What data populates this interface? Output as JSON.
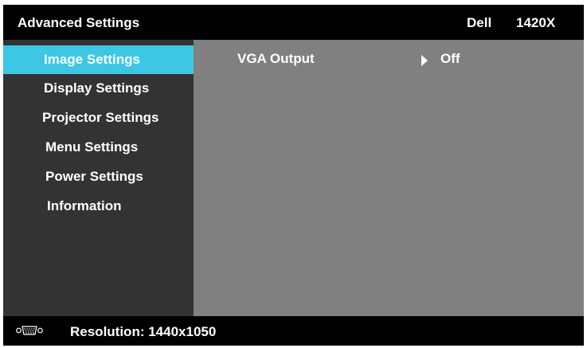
{
  "header": {
    "title": "Advanced Settings",
    "brand": "Dell",
    "model": "1420X"
  },
  "sidebar": {
    "items": [
      {
        "label": "Image Settings",
        "active": true
      },
      {
        "label": "Display Settings",
        "active": false
      },
      {
        "label": "Projector Settings",
        "active": false
      },
      {
        "label": "Menu Settings",
        "active": false
      },
      {
        "label": "Power Settings",
        "active": false
      },
      {
        "label": "Information",
        "active": false
      }
    ]
  },
  "content": {
    "options": [
      {
        "label": "VGA Output",
        "value": "Off"
      }
    ]
  },
  "status": {
    "icon": "vga-connector-icon",
    "resolution": "Resolution: 1440x1050"
  },
  "colors": {
    "accent": "#3cc7e5",
    "sidebar": "#333333",
    "content": "#808080",
    "bar": "#000000"
  }
}
